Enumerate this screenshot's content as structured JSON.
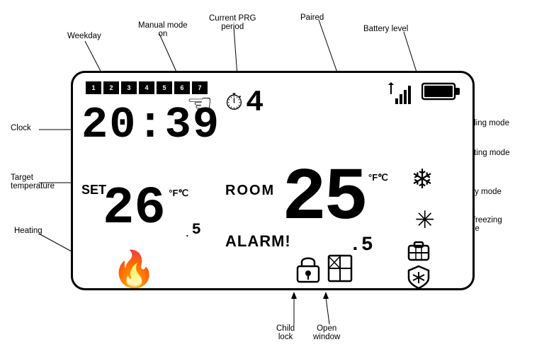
{
  "labels": {
    "weekday": "Weekday",
    "manual_mode": "Manual mode\non",
    "current_prg": "Current PRG\nperiod",
    "paired": "Paired",
    "battery_level": "Battery level",
    "clock": "Clock",
    "target_temperature": "Target\ntemperature",
    "heating": "Heating",
    "cooling_mode": "Cooling mode",
    "heating_mode": "Heating mode",
    "away_mode": "Away mode",
    "antifreezing_mode": "Antifreezing\nmode",
    "child_lock": "Child\nlock",
    "open_window": "Open\nwindow"
  },
  "display": {
    "weekdays": [
      "1",
      "2",
      "3",
      "4",
      "5",
      "6",
      "7"
    ],
    "clock": "20:39",
    "prg_period": "4",
    "target_temp": "26",
    "target_decimal": "5",
    "target_unit": "°F℃",
    "room_label": "ROOM",
    "room_temp": "25",
    "room_decimal": "5",
    "room_unit": "°F℃",
    "set_label": "SET",
    "alarm_label": "ALARM!"
  },
  "colors": {
    "primary": "#000000",
    "background": "#ffffff"
  }
}
